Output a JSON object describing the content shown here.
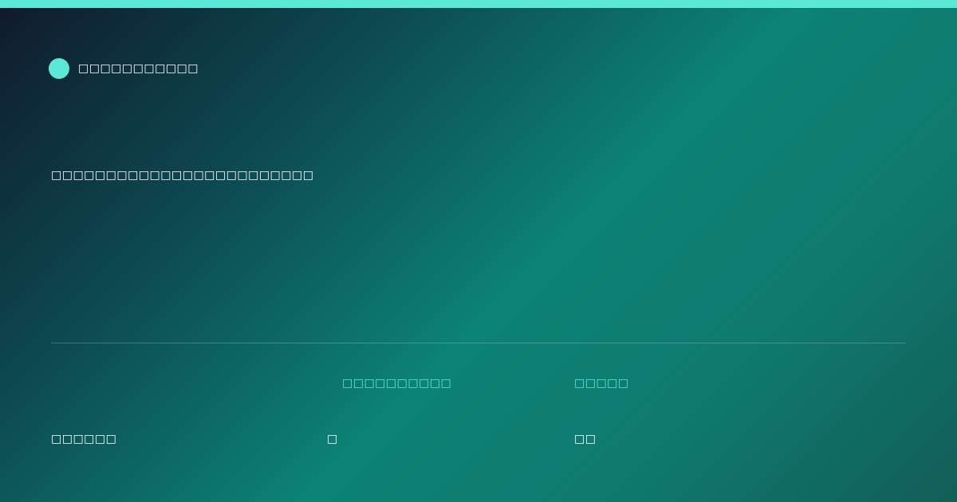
{
  "brand": {
    "name": "□□□□□□□□□□□",
    "accent_color": "#5ce8d6"
  },
  "headline": "□□□□□□□□□□□□□□□□□□□□□□□□",
  "stats": [
    {
      "label": "",
      "value": "□□□□□□"
    },
    {
      "label": "□□□□□□□□□□",
      "value": "□"
    },
    {
      "label": "□□□□□",
      "value": "□□"
    }
  ]
}
